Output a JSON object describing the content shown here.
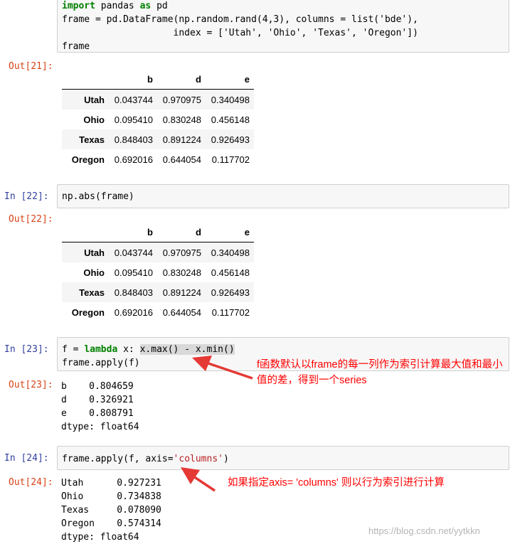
{
  "cell21": {
    "code_lines": [
      [
        "import",
        " pandas ",
        "as",
        " pd"
      ],
      "frame = pd.DataFrame(np.random.rand(4,3), columns = list('bde'),",
      "                    index = ['Utah', 'Ohio', 'Texas', 'Oregon'])",
      "frame"
    ],
    "out_prompt": "Out[21]:"
  },
  "table1": {
    "columns": [
      "b",
      "d",
      "e"
    ],
    "rows": [
      {
        "index": "Utah",
        "values": [
          "0.043744",
          "0.970975",
          "0.340498"
        ]
      },
      {
        "index": "Ohio",
        "values": [
          "0.095410",
          "0.830248",
          "0.456148"
        ]
      },
      {
        "index": "Texas",
        "values": [
          "0.848403",
          "0.891224",
          "0.926493"
        ]
      },
      {
        "index": "Oregon",
        "values": [
          "0.692016",
          "0.644054",
          "0.117702"
        ]
      }
    ]
  },
  "cell22": {
    "in_prompt": "In  [22]:",
    "code": "np.abs(frame)",
    "out_prompt": "Out[22]:"
  },
  "table2": {
    "columns": [
      "b",
      "d",
      "e"
    ],
    "rows": [
      {
        "index": "Utah",
        "values": [
          "0.043744",
          "0.970975",
          "0.340498"
        ]
      },
      {
        "index": "Ohio",
        "values": [
          "0.095410",
          "0.830248",
          "0.456148"
        ]
      },
      {
        "index": "Texas",
        "values": [
          "0.848403",
          "0.891224",
          "0.926493"
        ]
      },
      {
        "index": "Oregon",
        "values": [
          "0.692016",
          "0.644054",
          "0.117702"
        ]
      }
    ]
  },
  "cell23": {
    "in_prompt": "In  [23]:",
    "line1_var": "f = ",
    "line1_kw": "lambda",
    "line1_rest": " x: ",
    "line1_hl": "x.max() - x.min()",
    "line2": "frame.apply(f)",
    "out_prompt": "Out[23]:",
    "output": "b    0.804659\nd    0.326921\ne    0.808791\ndtype: float64"
  },
  "annotation1": "f函数默认以frame的每一列作为索引计算最大值和最小值的差，得到一个series",
  "cell24": {
    "in_prompt": "In  [24]:",
    "code_pre": "frame.apply(f, axis=",
    "code_str": "'columns'",
    "code_post": ")",
    "out_prompt": "Out[24]:",
    "output": "Utah      0.927231\nOhio      0.734838\nTexas     0.078090\nOregon    0.574314\ndtype: float64"
  },
  "annotation2": "如果指定axis= 'columns' 则以行为索引进行计算",
  "watermark": "https://blog.csdn.net/yytkkn",
  "colors": {
    "in_prompt": "#303f9f",
    "out_prompt": "#d84315",
    "annotation": "#ff0000",
    "input_bg": "#f7f7f7"
  }
}
